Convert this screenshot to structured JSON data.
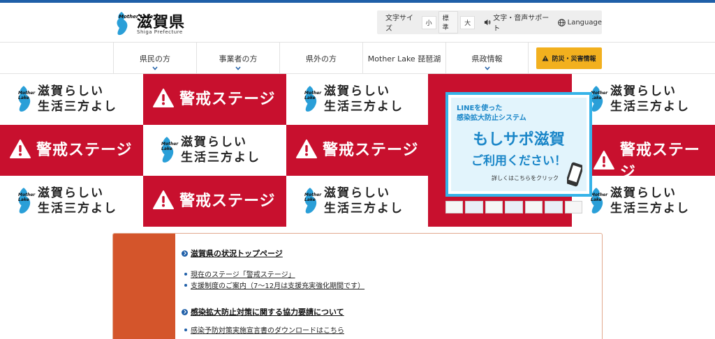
{
  "header": {
    "logo_ja": "滋賀県",
    "logo_en": "Shiga Prefecture",
    "logo_mark_text": "Mother Lake"
  },
  "util": {
    "font_size_label": "文字サイズ",
    "sizes": [
      "小",
      "標準",
      "大"
    ],
    "support": "文字・音声サポート",
    "language": "Language"
  },
  "nav": {
    "items": [
      "県民の方",
      "事業者の方",
      "県外の方",
      "Mother Lake 琵琶湖",
      "県政情報"
    ],
    "bosai": "防災・災害情報"
  },
  "banner": {
    "keikai": "警戒ステージ",
    "slogan_line1": "滋賀らしい",
    "slogan_line2": "生活三方よし",
    "slogan_mark": "Mother Lake",
    "line_card": {
      "line1": "LINEを使った",
      "line2": "感染拡大防止システム",
      "big": "もしサポ滋賀",
      "use": "ご利用ください！",
      "click": "詳しくはこちらをクリック"
    }
  },
  "content": {
    "section1_title": "滋賀県の状況トップページ",
    "links1": [
      "現在のステージ「警戒ステージ」",
      "支援制度のご案内（7〜12月は支援充実強化期間です）"
    ],
    "section2_title": "感染拡大防止対策に関する協力要請について",
    "links2": [
      "感染予防対策実施宣言書のダウンロードはこちら"
    ]
  },
  "colors": {
    "brand_blue": "#1f5fa8",
    "alert_red": "#c8102e",
    "line_blue": "#35b3e8",
    "bosai_yellow": "#f2b01e",
    "panel_orange": "#d4552b"
  }
}
